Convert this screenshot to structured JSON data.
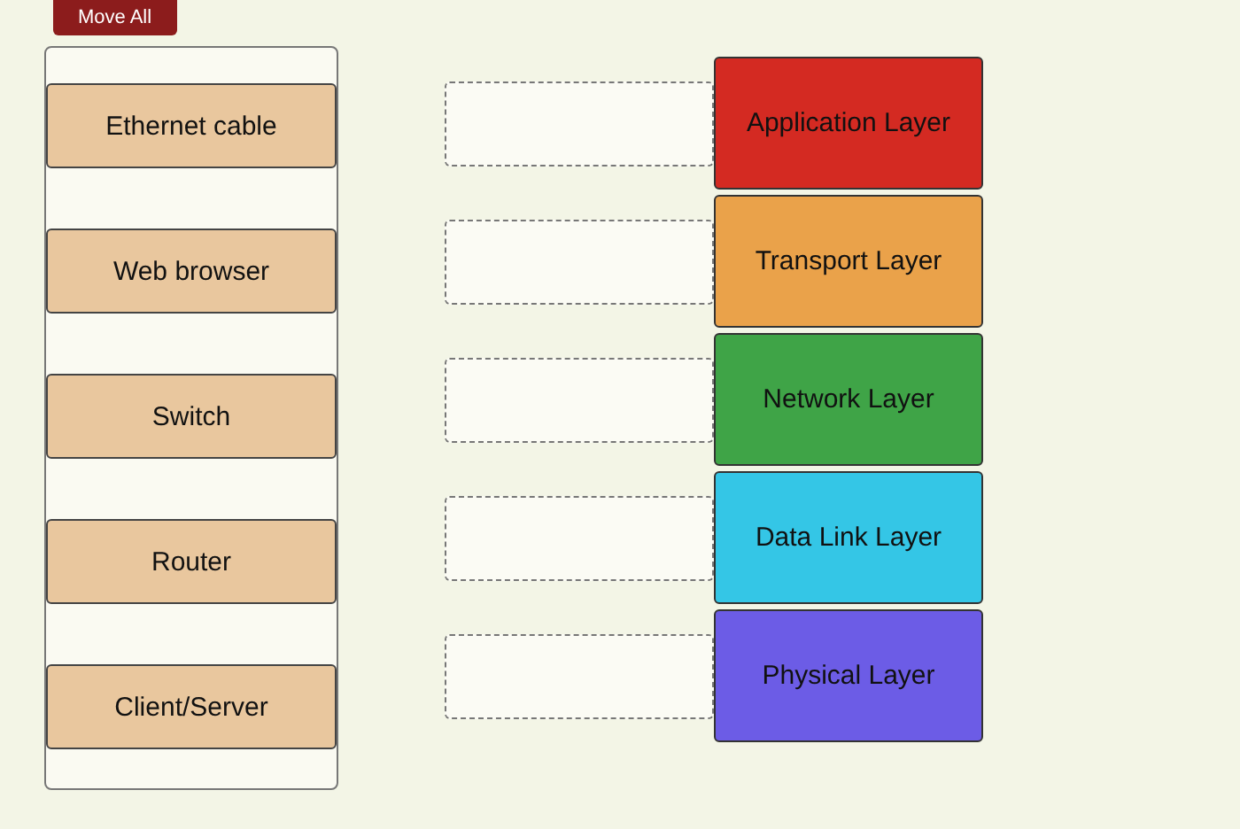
{
  "move_all_button": {
    "label": "Move All"
  },
  "items": [
    {
      "label": "Ethernet cable"
    },
    {
      "label": "Web browser"
    },
    {
      "label": "Switch"
    },
    {
      "label": "Router"
    },
    {
      "label": "Client/Server"
    }
  ],
  "layers": [
    {
      "label": "Application Layer",
      "color": "#d42a22"
    },
    {
      "label": "Transport Layer",
      "color": "#eaa24a"
    },
    {
      "label": "Network Layer",
      "color": "#3fa447"
    },
    {
      "label": "Data Link Layer",
      "color": "#34c6e6"
    },
    {
      "label": "Physical Layer",
      "color": "#6c5ce6"
    }
  ]
}
